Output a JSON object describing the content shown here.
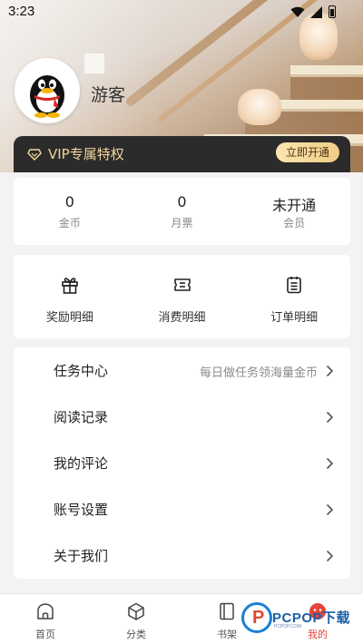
{
  "status_bar": {
    "time": "3:23",
    "icons": [
      "wifi-icon",
      "signal-icon",
      "battery-icon"
    ]
  },
  "profile": {
    "username": "游客",
    "avatar": "qq-penguin-avatar"
  },
  "vip": {
    "label": "VIP专属特权",
    "button": "立即开通",
    "icon": "diamond-icon"
  },
  "stats": [
    {
      "value": "0",
      "label": "金币"
    },
    {
      "value": "0",
      "label": "月票"
    },
    {
      "value": "未开通",
      "label": "会员"
    }
  ],
  "actions": [
    {
      "label": "奖励明细",
      "icon": "gift-icon"
    },
    {
      "label": "消费明细",
      "icon": "ticket-icon"
    },
    {
      "label": "订单明细",
      "icon": "clipboard-icon"
    }
  ],
  "menu": [
    {
      "label": "任务中心",
      "hint": "每日做任务领海量金币"
    },
    {
      "label": "阅读记录",
      "hint": ""
    },
    {
      "label": "我的评论",
      "hint": ""
    },
    {
      "label": "账号设置",
      "hint": ""
    },
    {
      "label": "关于我们",
      "hint": ""
    }
  ],
  "bottom_nav": [
    {
      "label": "首页",
      "icon": "home-icon",
      "active": false
    },
    {
      "label": "分类",
      "icon": "cube-icon",
      "active": false
    },
    {
      "label": "书架",
      "icon": "book-icon",
      "active": false
    },
    {
      "label": "我的",
      "icon": "profile-icon",
      "active": true
    }
  ],
  "watermark": {
    "brand": "PCPOP下载",
    "sub": "PCPOP.COM"
  },
  "colors": {
    "vip_bar": "#2b2b2b",
    "vip_gold": "#f1d49a",
    "active_nav": "#e0463a",
    "page_bg": "#f3f3f5"
  }
}
